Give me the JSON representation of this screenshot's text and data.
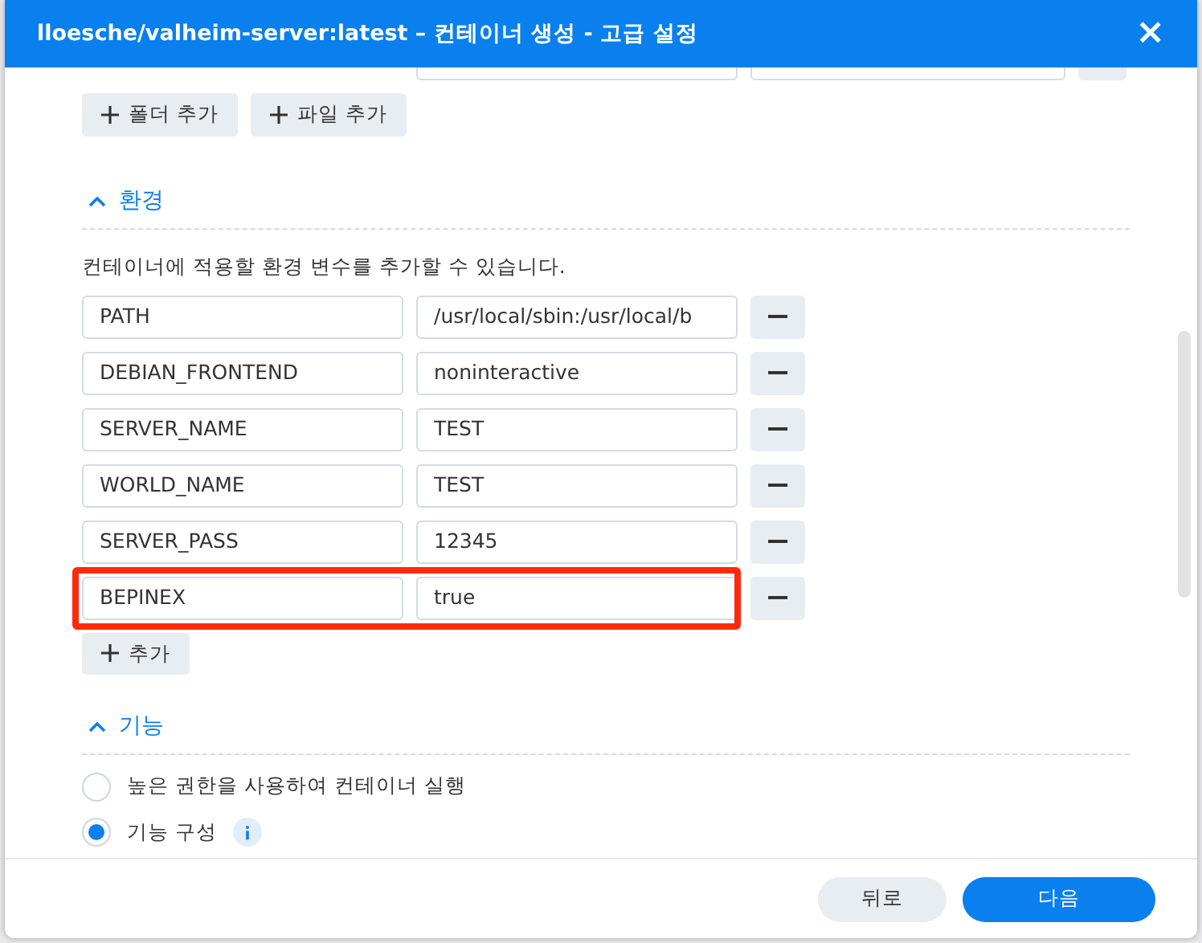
{
  "window": {
    "title": "lloesche/valheim-server:latest – 컨테이너 생성 - 고급 설정",
    "close": "×"
  },
  "storage_buttons": [
    {
      "label": "폴더 추가"
    },
    {
      "label": "파일 추가"
    }
  ],
  "environment": {
    "title": "환경",
    "expanded": true,
    "description": "컨테이너에 적용할 환경 변수를 추가할 수 있습니다.",
    "variables": [
      {
        "name": "PATH",
        "value": "/usr/local/sbin:/usr/local/b",
        "highlighted": false
      },
      {
        "name": "DEBIAN_FRONTEND",
        "value": "noninteractive",
        "highlighted": false
      },
      {
        "name": "SERVER_NAME",
        "value": "TEST",
        "highlighted": false
      },
      {
        "name": "WORLD_NAME",
        "value": "TEST",
        "highlighted": false
      },
      {
        "name": "SERVER_PASS",
        "value": "12345",
        "highlighted": false
      },
      {
        "name": "BEPINEX",
        "value": "true",
        "highlighted": true
      }
    ],
    "add_button": "추가"
  },
  "capabilities": {
    "title": "기능",
    "expanded": true,
    "options": [
      {
        "label": "높은 권한을 사용하여 컨테이너 실행",
        "selected": false,
        "info": false
      },
      {
        "label": "기능 구성",
        "selected": true,
        "info": true
      }
    ]
  },
  "footer": {
    "back": "뒤로",
    "next": "다음"
  }
}
